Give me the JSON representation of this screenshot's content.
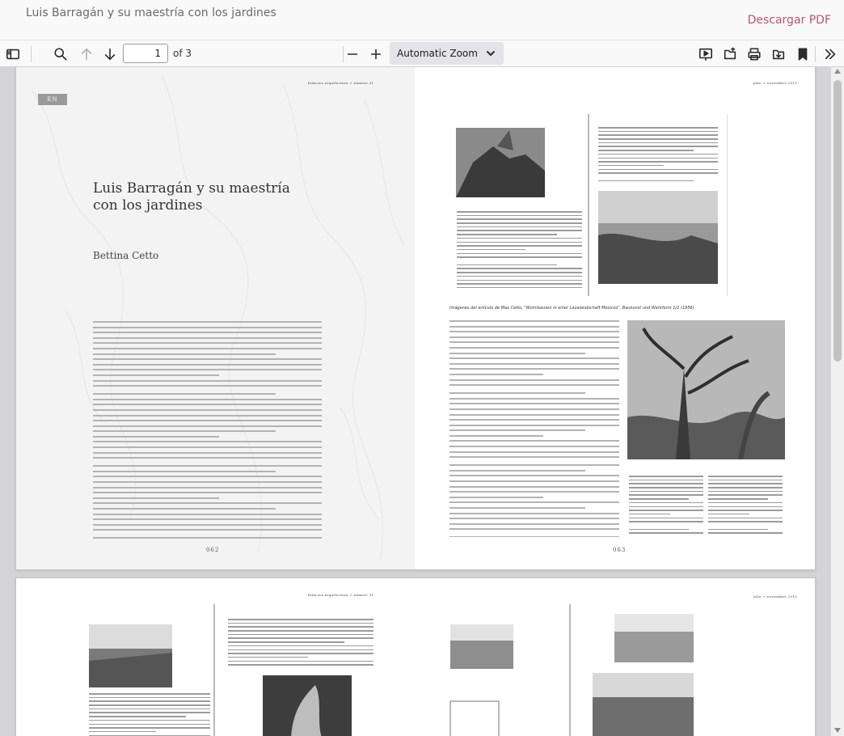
{
  "document": {
    "title": "Luis Barragán y su maestría con los jardines",
    "download_label": "Descargar PDF"
  },
  "toolbar": {
    "sidebar_toggle_icon": "sidebar-icon",
    "search_icon": "search-icon",
    "prev_icon": "arrow-up-icon",
    "next_icon": "arrow-down-icon",
    "page_number": "1",
    "page_count_label": "of 3",
    "zoom_out_icon": "minus-icon",
    "zoom_in_icon": "plus-icon",
    "zoom_label": "Automatic Zoom",
    "presentation_icon": "presentation-icon",
    "open_icon": "open-file-icon",
    "print_icon": "print-icon",
    "download_icon": "download-icon",
    "bookmark_icon": "bookmark-icon",
    "more_icon": "double-chevron-icon"
  },
  "pages": {
    "spread1": {
      "running_head_left": "bitácora arquitectura + número 31",
      "running_head_right": "julio + noviembre 2015",
      "language_badge": "EN",
      "article_title": "Luis Barragán y su maestría con los jardines",
      "article_author": "Bettina Cetto",
      "figure_caption": "Imágenes del artículo de Max Cetto, \"Wohnbauten in einer Lavalandschaft Mexicos\", Baukunst und Werkform 1/2 (1956)",
      "page_left_number": "062",
      "page_right_number": "063"
    },
    "spread2": {
      "running_head_left": "bitácora arquitectura + número 31",
      "running_head_right": "julio + noviembre 2015"
    }
  },
  "colors": {
    "accent_link": "#c0507a",
    "toolbar_bg": "#f9f9fa",
    "viewer_bg": "#d4d4d7"
  }
}
